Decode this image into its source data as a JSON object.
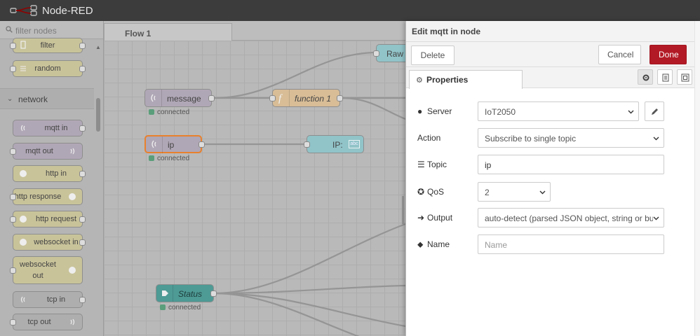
{
  "header": {
    "title": "Node-RED"
  },
  "palette": {
    "filter_placeholder": "filter nodes",
    "category": "network",
    "items_top": [
      {
        "label": "filter"
      },
      {
        "label": "random"
      }
    ],
    "items": [
      {
        "label": "mqtt in"
      },
      {
        "label": "mqtt out"
      },
      {
        "label": "http in"
      },
      {
        "label": "http response"
      },
      {
        "label": "http request"
      },
      {
        "label": "websocket in"
      },
      {
        "label_line1": "websocket",
        "label_line2": "out"
      },
      {
        "label": "tcp in"
      },
      {
        "label": "tcp out"
      }
    ]
  },
  "flow": {
    "tab_label": "Flow 1"
  },
  "workspace": {
    "nodes": {
      "raw": "Raw",
      "message": "message",
      "function1": "function 1",
      "ip": "ip",
      "ip_out": "IP:",
      "ip_out_badge": "abc",
      "status": "Status"
    },
    "status_connected": "connected"
  },
  "tray": {
    "title": "Edit mqtt in node",
    "delete": "Delete",
    "cancel": "Cancel",
    "done": "Done",
    "tab_properties": "Properties",
    "fields": {
      "server_label": "Server",
      "server_value": "IoT2050",
      "action_label": "Action",
      "action_value": "Subscribe to single topic",
      "topic_label": "Topic",
      "topic_value": "ip",
      "qos_label": "QoS",
      "qos_value": "2",
      "output_label": "Output",
      "output_value": "auto-detect (parsed JSON object, string or buffer)",
      "name_label": "Name",
      "name_placeholder": "Name"
    }
  },
  "colors": {
    "done": "#b21a25",
    "mqtt": "#b0a7b6",
    "http": "#c9c39a",
    "function": "#d8bd97",
    "status": "#4e9a95"
  }
}
